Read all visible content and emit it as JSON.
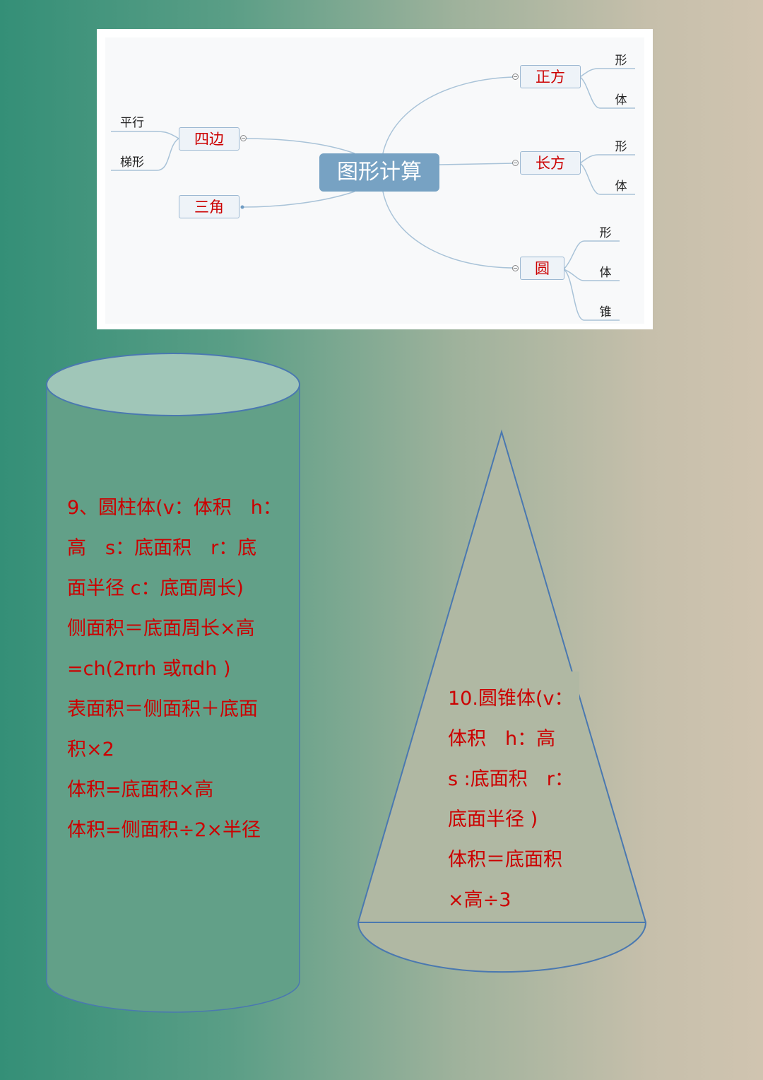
{
  "mindmap": {
    "central": "图形计算",
    "left_topics": [
      {
        "label": "四边",
        "children": [
          "平行",
          "梯形"
        ]
      },
      {
        "label": "三角",
        "children": []
      }
    ],
    "right_topics": [
      {
        "label": "正方",
        "children": [
          "形",
          "体"
        ]
      },
      {
        "label": "长方",
        "children": [
          "形",
          "体"
        ]
      },
      {
        "label": "圆",
        "children": [
          "形",
          "体",
          "锥"
        ]
      }
    ]
  },
  "cylinder": {
    "shape": "cylinder",
    "lines": [
      "9、圆柱体(v：体积　h：",
      "高　s：底面积　r：底",
      "面半径 c：底面周长)",
      "侧面积＝底面周长×高",
      "=ch(2πrh 或πdh )",
      "表面积＝侧面积＋底面",
      "积×2",
      "体积=底面积×高",
      "体积=侧面积÷2×半径"
    ]
  },
  "cone": {
    "shape": "cone",
    "lines": [
      "10.圆锥体(v：",
      "体积　h：高",
      "s :底面积　r：",
      "底面半径 )",
      "体积＝底面积",
      "×高÷3"
    ]
  },
  "colors": {
    "formula_text": "#cc0000",
    "shape_stroke": "#4a78b0",
    "central_node": "#77a2c3"
  }
}
